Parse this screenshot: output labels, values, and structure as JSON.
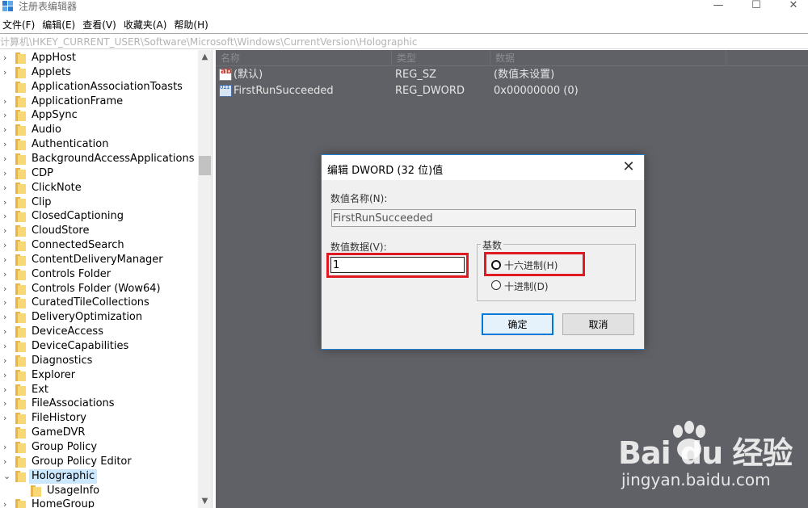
{
  "window": {
    "title": "注册表编辑器",
    "min_glyph": "—",
    "max_glyph": "☐",
    "close_glyph": "✕"
  },
  "menu": [
    "文件(F)",
    "编辑(E)",
    "查看(V)",
    "收藏夹(A)",
    "帮助(H)"
  ],
  "address": "计算机\\HKEY_CURRENT_USER\\Software\\Microsoft\\Windows\\CurrentVersion\\Holographic",
  "tree": {
    "items": [
      {
        "label": "AppHost",
        "expander": "›"
      },
      {
        "label": "Applets",
        "expander": "›"
      },
      {
        "label": "ApplicationAssociationToasts",
        "expander": ""
      },
      {
        "label": "ApplicationFrame",
        "expander": "›"
      },
      {
        "label": "AppSync",
        "expander": "›"
      },
      {
        "label": "Audio",
        "expander": "›"
      },
      {
        "label": "Authentication",
        "expander": "›"
      },
      {
        "label": "BackgroundAccessApplications",
        "expander": "›"
      },
      {
        "label": "CDP",
        "expander": "›"
      },
      {
        "label": "ClickNote",
        "expander": "›"
      },
      {
        "label": "Clip",
        "expander": "›"
      },
      {
        "label": "ClosedCaptioning",
        "expander": "›"
      },
      {
        "label": "CloudStore",
        "expander": "›"
      },
      {
        "label": "ConnectedSearch",
        "expander": "›"
      },
      {
        "label": "ContentDeliveryManager",
        "expander": "›"
      },
      {
        "label": "Controls Folder",
        "expander": "›"
      },
      {
        "label": "Controls Folder (Wow64)",
        "expander": "›"
      },
      {
        "label": "CuratedTileCollections",
        "expander": "›"
      },
      {
        "label": "DeliveryOptimization",
        "expander": "›"
      },
      {
        "label": "DeviceAccess",
        "expander": "›"
      },
      {
        "label": "DeviceCapabilities",
        "expander": "›"
      },
      {
        "label": "Diagnostics",
        "expander": "›"
      },
      {
        "label": "Explorer",
        "expander": "›"
      },
      {
        "label": "Ext",
        "expander": "›"
      },
      {
        "label": "FileAssociations",
        "expander": "›"
      },
      {
        "label": "FileHistory",
        "expander": "›"
      },
      {
        "label": "GameDVR",
        "expander": ""
      },
      {
        "label": "Group Policy",
        "expander": "›"
      },
      {
        "label": "Group Policy Editor",
        "expander": "›"
      },
      {
        "label": "Holographic",
        "expander": "⌄",
        "selected": true
      },
      {
        "label": "UsageInfo",
        "expander": "",
        "indent": 1
      },
      {
        "label": "HomeGroup",
        "expander": "›"
      }
    ]
  },
  "list": {
    "columns": [
      "名称",
      "类型",
      "数据"
    ],
    "rows": [
      {
        "name": "(默认)",
        "type": "REG_SZ",
        "data": "(数值未设置)",
        "icon": "string-value-icon"
      },
      {
        "name": "FirstRunSucceeded",
        "type": "REG_DWORD",
        "data": "0x00000000 (0)",
        "icon": "binary-value-icon"
      }
    ]
  },
  "dialog": {
    "title": "编辑 DWORD (32 位)值",
    "name_label": "数值名称(N):",
    "name_value": "FirstRunSucceeded",
    "data_label": "数值数据(V):",
    "data_value": "1",
    "base_label": "基数",
    "hex_label": "十六进制(H)",
    "dec_label": "十进制(D)",
    "ok_label": "确定",
    "cancel_label": "取消",
    "close_glyph": "✕",
    "highlight_color": "#e01a22"
  },
  "watermark": {
    "logo": "Bai  du 经验",
    "url": "jingyan.baidu.com"
  }
}
